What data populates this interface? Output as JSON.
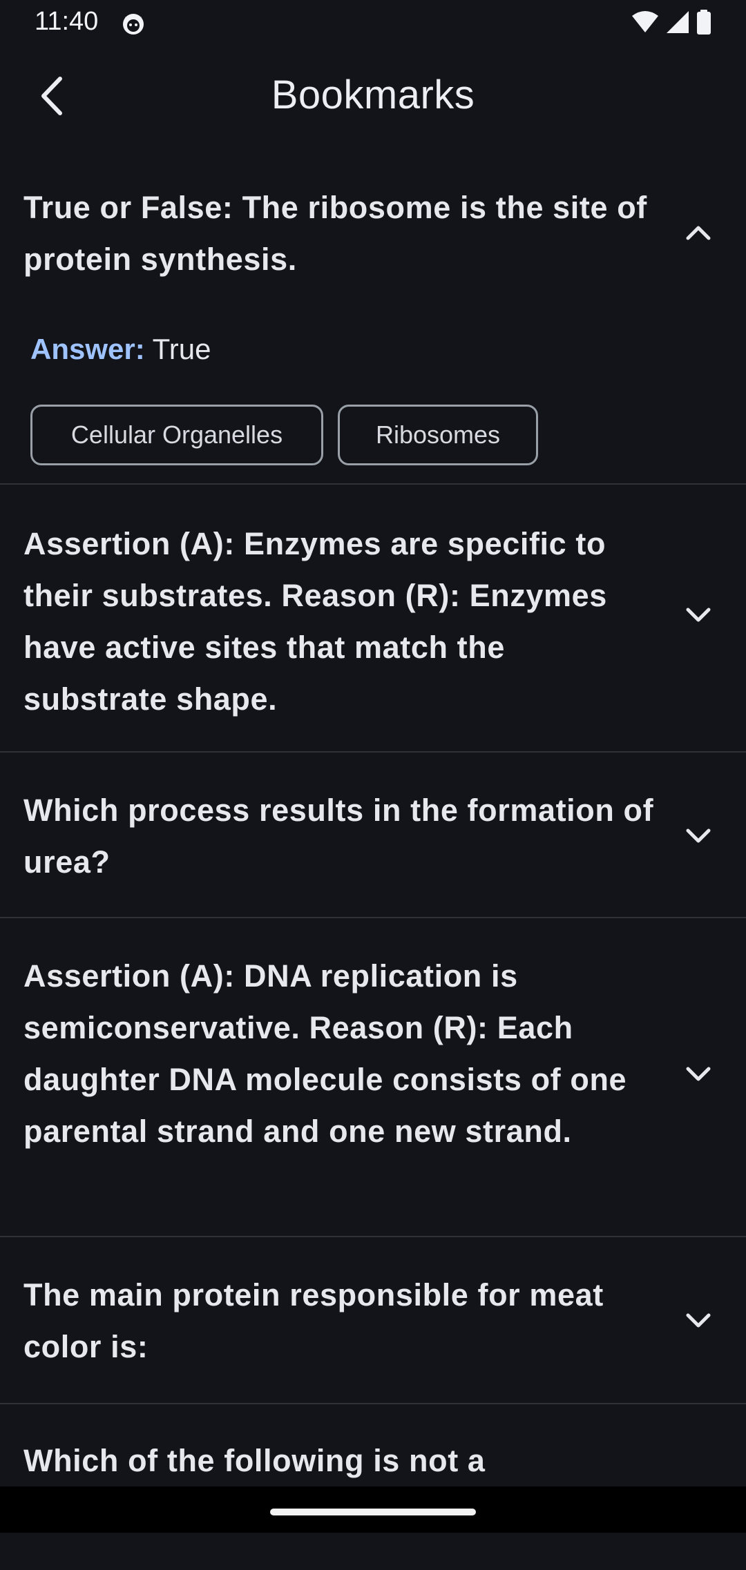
{
  "status_bar": {
    "time": "11:40",
    "icons": [
      "app-notification-icon",
      "wifi-icon",
      "cellular-signal-icon",
      "battery-icon"
    ]
  },
  "header": {
    "title": "Bookmarks",
    "back_icon": "back-arrow-icon"
  },
  "bookmarks": [
    {
      "question": "True or False: The ribosome is the site of protein synthesis.",
      "expanded": true,
      "answer_label": "Answer:",
      "answer_value": "True",
      "tags": [
        "Cellular Organelles",
        "Ribosomes"
      ]
    },
    {
      "question": "Assertion (A): Enzymes are specific to their substrates. Reason (R): Enzymes have active sites that match the substrate shape.",
      "expanded": false
    },
    {
      "question": "Which process results in the formation of urea?",
      "expanded": false
    },
    {
      "question": "Assertion (A): DNA replication is semiconservative. Reason (R): Each daughter DNA molecule consists of one parental strand and one new strand.",
      "expanded": false
    },
    {
      "question": "The main protein responsible for meat color is:",
      "expanded": false
    },
    {
      "question": "Which of the following is not a",
      "expanded": false
    }
  ],
  "colors": {
    "background": "#121419",
    "answer_label": "#9fc3ff",
    "divider": "#2f3238"
  }
}
